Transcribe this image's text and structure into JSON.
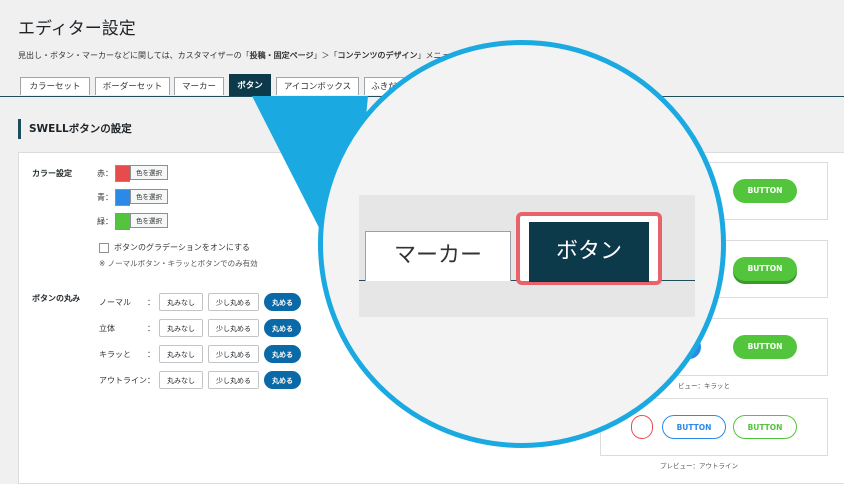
{
  "page": {
    "title": "エディター設定"
  },
  "desc": {
    "pre": "見出し・ボタン・マーカーなどに関しては、カスタマイザーの「",
    "link1": "投稿・固定ページ",
    "mid": "」＞「",
    "link2": "コンテンツのデザイン",
    "post": "」メニューから設"
  },
  "tabs": [
    "カラーセット",
    "ボーダーセット",
    "マーカー",
    "ボタン",
    "アイコンボックス",
    "ふきだ"
  ],
  "section_title": "SWELLボタンの設定",
  "colors": {
    "label": "カラー設定",
    "items": [
      {
        "label": "赤：",
        "swatch": "#e84b4b",
        "button": "色を選択"
      },
      {
        "label": "青：",
        "swatch": "#2b8ae8",
        "button": "色を選択"
      },
      {
        "label": "緑：",
        "swatch": "#52c53c",
        "button": "色を選択"
      }
    ],
    "gradient_label": "ボタンのグラデーションをオンにする",
    "gradient_note": "※ ノーマルボタン・キラッとボタンでのみ有効"
  },
  "radius": {
    "label": "ボタンの丸み",
    "options": [
      "丸みなし",
      "少し丸める",
      "丸める"
    ],
    "rows": [
      {
        "label": "ノーマル",
        "sep": "："
      },
      {
        "label": "立体",
        "sep": "："
      },
      {
        "label": "キラッと",
        "sep": "："
      },
      {
        "label": "アウトライン",
        "sep": "："
      }
    ]
  },
  "preview": {
    "button_text": "BUTTON",
    "label_kira": "ビュー：キラッと",
    "label_outline": "プレビュー：アウトライン"
  },
  "zoom": {
    "tab_marker": "マーカー",
    "tab_button": "ボタン"
  },
  "theme_colors": {
    "accent": "#0c3a4b",
    "callout": "#1aa9e0",
    "highlight": "#e8626c",
    "green": "#52c53c",
    "blue": "#2b8ae8",
    "red": "#e84b4b"
  }
}
